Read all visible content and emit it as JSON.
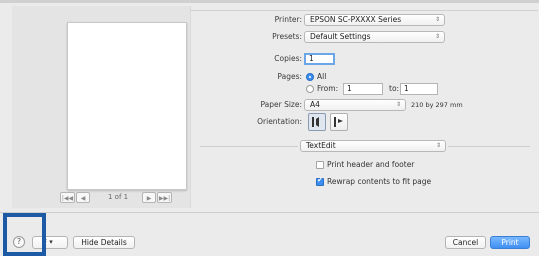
{
  "preview": {
    "nav_first": "|◀◀",
    "nav_prev": "◀",
    "page_indicator": "1 of 1",
    "nav_next": "▶",
    "nav_last": "▶▶|"
  },
  "printer": {
    "label": "Printer:",
    "value": "EPSON SC-PXXXX Series"
  },
  "presets": {
    "label": "Presets:",
    "value": "Default Settings"
  },
  "copies": {
    "label": "Copies:",
    "value": "1"
  },
  "pages": {
    "label": "Pages:",
    "all_label": "All",
    "from_label": "From:",
    "from_value": "1",
    "to_label": "to:",
    "to_value": "1",
    "selected": "All"
  },
  "paper_size": {
    "label": "Paper Size:",
    "value": "A4",
    "dimensions": "210 by 297 mm"
  },
  "orientation": {
    "label": "Orientation:",
    "selected": "portrait"
  },
  "section_popup": {
    "value": "TextEdit"
  },
  "options": {
    "print_header_footer": {
      "label": "Print header and footer",
      "checked": false
    },
    "rewrap": {
      "label": "Rewrap contents to fit page",
      "checked": true
    }
  },
  "bottom": {
    "help": "?",
    "pdf_label": "F ▾",
    "hide_details": "Hide Details",
    "cancel": "Cancel",
    "print": "Print"
  },
  "colors": {
    "accent": "#3f8ff2",
    "highlight_frame": "#1c5aa6",
    "dialog_bg": "#ebebeb"
  }
}
